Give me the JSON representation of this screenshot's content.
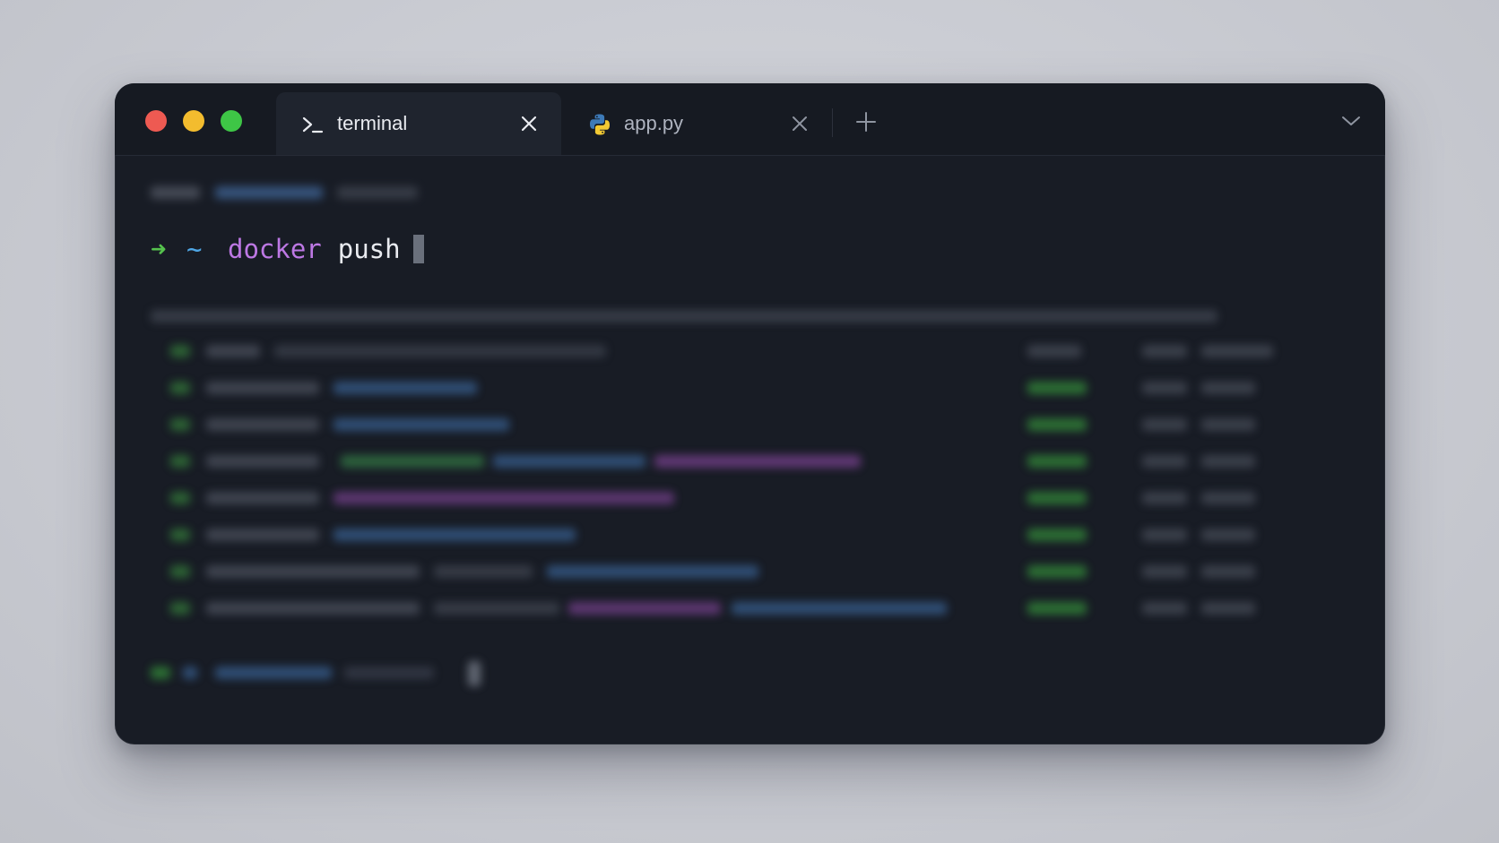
{
  "window": {
    "traffic_lights": [
      "close",
      "minimize",
      "zoom"
    ]
  },
  "tabs": [
    {
      "label": "terminal",
      "icon": "terminal-prompt-icon",
      "active": true
    },
    {
      "label": "app.py",
      "icon": "python-icon",
      "active": false
    }
  ],
  "toolbar": {
    "new_tab_icon": "plus-icon",
    "menu_icon": "chevron-down-icon"
  },
  "terminal": {
    "prompt_arrow": "➜",
    "prompt_dir": "~",
    "command": "docker",
    "argument": "push"
  },
  "colors": {
    "window_bg": "#181c25",
    "prompt_arrow": "#55c24d",
    "prompt_dir": "#4fa7e6",
    "command": "#bd78e4",
    "text": "#e9ebf0",
    "close": "#ee5a52",
    "minimize": "#f3bc2e",
    "zoom": "#3ec646"
  }
}
